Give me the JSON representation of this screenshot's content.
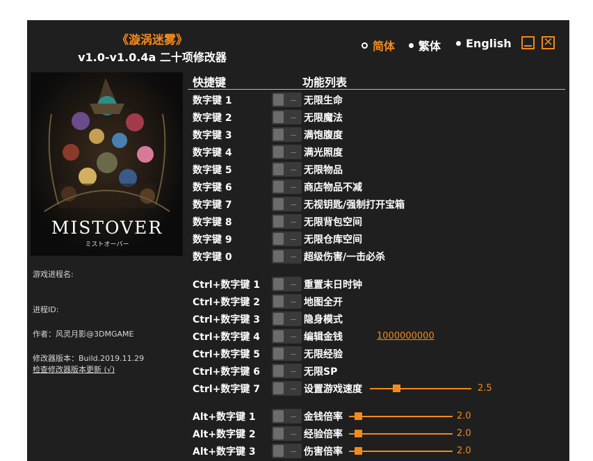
{
  "title": {
    "game": "《漩涡迷雾》",
    "subtitle": "v1.0-v1.0.4a 二十项修改器"
  },
  "languages": [
    {
      "label": "简体",
      "selected": true
    },
    {
      "label": "繁体",
      "selected": false
    },
    {
      "label": "English",
      "selected": false
    }
  ],
  "window_buttons": {
    "close_glyph": "✕"
  },
  "cover": {
    "logo_text": "MISTOVER",
    "logo_sub": "ミストオーバー"
  },
  "sidebar": {
    "process_name_label": "游戏进程名:",
    "process_id_label": "进程ID:",
    "author": "作者：风灵月影@3DMGAME",
    "version": "修改器版本：Build.2019.11.29",
    "check_update": "检查修改器版本更新 (√)"
  },
  "headers": {
    "hotkey": "快捷键",
    "features": "功能列表"
  },
  "rows": [
    {
      "key": "数字键 1",
      "label": "无限生命"
    },
    {
      "key": "数字键 2",
      "label": "无限魔法"
    },
    {
      "key": "数字键 3",
      "label": "满饱腹度"
    },
    {
      "key": "数字键 4",
      "label": "满光照度"
    },
    {
      "key": "数字键 5",
      "label": "无限物品"
    },
    {
      "key": "数字键 6",
      "label": "商店物品不减"
    },
    {
      "key": "数字键 7",
      "label": "无视钥匙/强制打开宝箱"
    },
    {
      "key": "数字键 8",
      "label": "无限背包空间"
    },
    {
      "key": "数字键 9",
      "label": "无限仓库空间"
    },
    {
      "key": "数字键 0",
      "label": "超级伤害/一击必杀"
    },
    {
      "key": "Ctrl+数字键 1",
      "label": "重置末日时钟"
    },
    {
      "key": "Ctrl+数字键 2",
      "label": "地图全开"
    },
    {
      "key": "Ctrl+数字键 3",
      "label": "隐身模式"
    },
    {
      "key": "Ctrl+数字键 4",
      "label": "编辑金钱",
      "value": "1000000000"
    },
    {
      "key": "Ctrl+数字键 5",
      "label": "无限经验"
    },
    {
      "key": "Ctrl+数字键 6",
      "label": "无限SP"
    },
    {
      "key": "Ctrl+数字键 7",
      "label": "设置游戏速度",
      "slider_value": "2.5"
    },
    {
      "key": "Alt+数字键 1",
      "label": "金钱倍率",
      "slider_value": "2.0"
    },
    {
      "key": "Alt+数字键 2",
      "label": "经验倍率",
      "slider_value": "2.0"
    },
    {
      "key": "Alt+数字键 3",
      "label": "伤害倍率",
      "slider_value": "2.0"
    }
  ],
  "colors": {
    "accent": "#f28a1d",
    "background": "#1f1f1f",
    "text": "#ffffff"
  }
}
